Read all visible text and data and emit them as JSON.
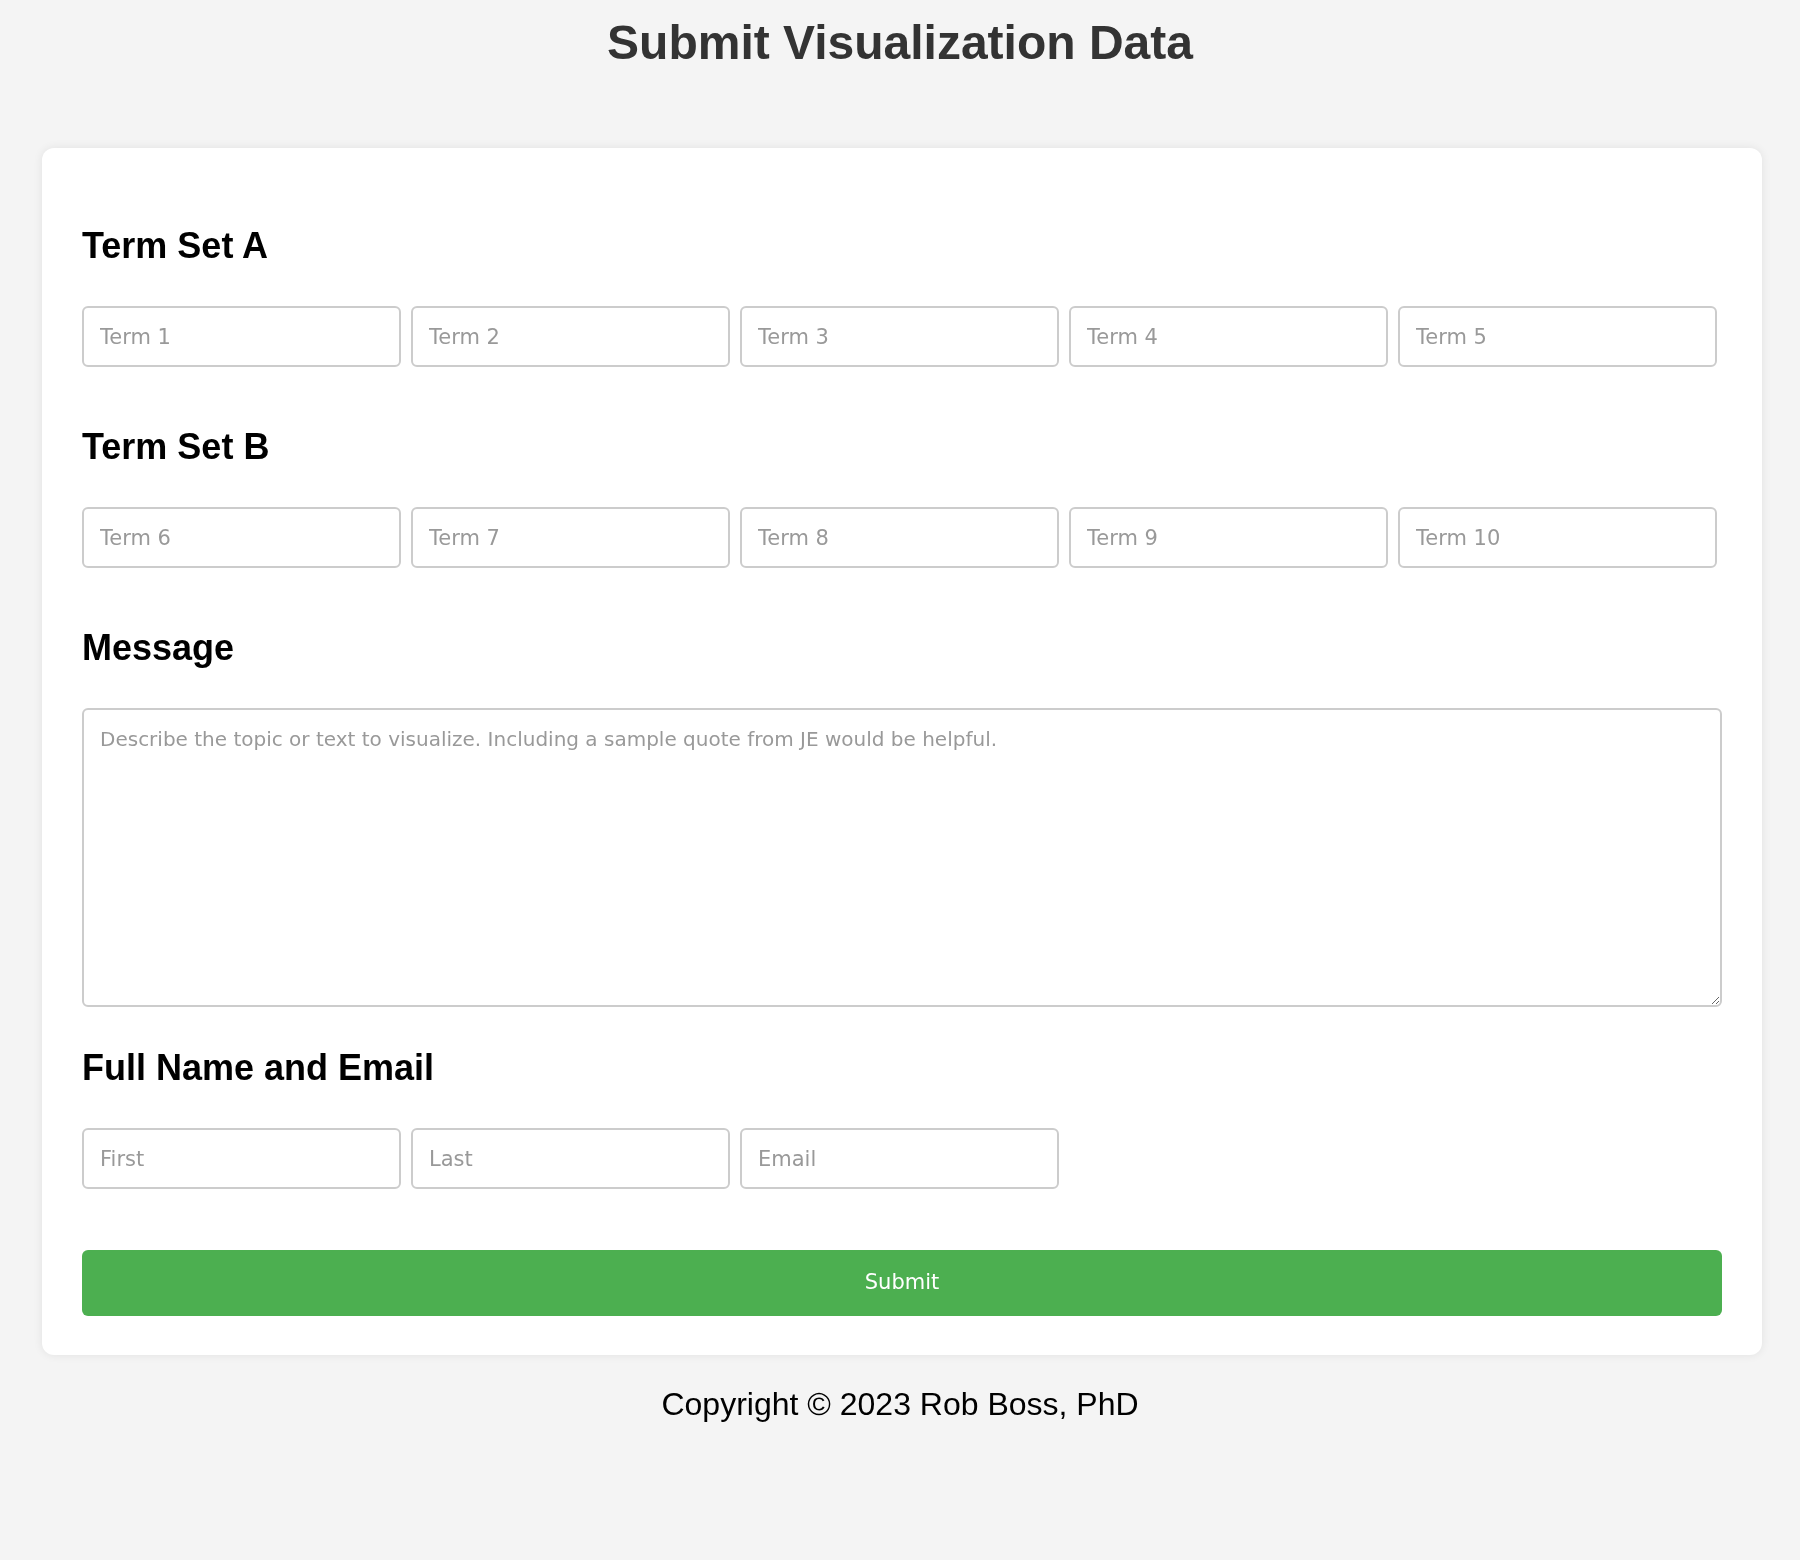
{
  "title": "Submit Visualization Data",
  "sections": [
    {
      "heading": "Term Set A",
      "kind": "inputs",
      "fields": [
        {
          "placeholder": "Term 1"
        },
        {
          "placeholder": "Term 2"
        },
        {
          "placeholder": "Term 3"
        },
        {
          "placeholder": "Term 4"
        },
        {
          "placeholder": "Term 5"
        }
      ]
    },
    {
      "heading": "Term Set B",
      "kind": "inputs",
      "fields": [
        {
          "placeholder": "Term 6"
        },
        {
          "placeholder": "Term 7"
        },
        {
          "placeholder": "Term 8"
        },
        {
          "placeholder": "Term 9"
        },
        {
          "placeholder": "Term 10"
        }
      ]
    },
    {
      "heading": "Message",
      "kind": "textarea",
      "fields": [
        {
          "placeholder": "Describe the topic or text to visualize. Including a sample quote from JE would be helpful."
        }
      ]
    },
    {
      "heading": "Full Name and Email",
      "kind": "inputs",
      "fields": [
        {
          "placeholder": "First"
        },
        {
          "placeholder": "Last"
        },
        {
          "placeholder": "Email"
        }
      ]
    }
  ],
  "submit": "Submit",
  "footer": "Copyright © 2023 Rob Boss, PhD"
}
